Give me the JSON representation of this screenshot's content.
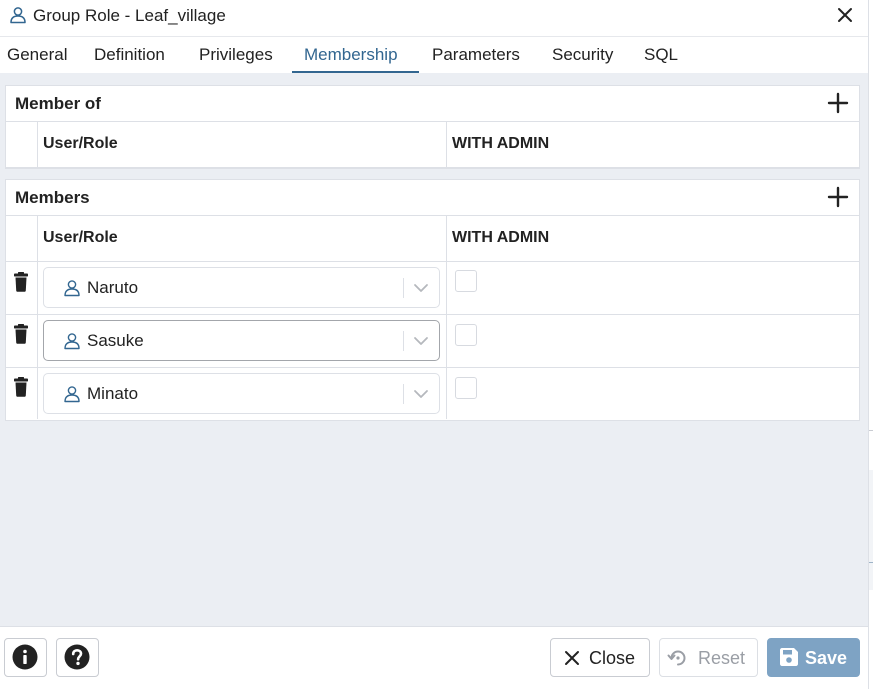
{
  "dialog": {
    "title": "Group Role - Leaf_village",
    "title_icon": "user-icon",
    "close_icon": "close-icon"
  },
  "tabs": [
    {
      "label": "General",
      "active": false
    },
    {
      "label": "Definition",
      "active": false
    },
    {
      "label": "Privileges",
      "active": false
    },
    {
      "label": "Membership",
      "active": true
    },
    {
      "label": "Parameters",
      "active": false
    },
    {
      "label": "Security",
      "active": false
    },
    {
      "label": "SQL",
      "active": false
    }
  ],
  "member_of": {
    "title": "Member of",
    "add_icon": "plus-icon",
    "columns": [
      "User/Role",
      "WITH ADMIN"
    ],
    "rows": []
  },
  "members": {
    "title": "Members",
    "add_icon": "plus-icon",
    "columns": [
      "User/Role",
      "WITH ADMIN"
    ],
    "rows": [
      {
        "role": "Naruto",
        "with_admin": false
      },
      {
        "role": "Sasuke",
        "with_admin": false
      },
      {
        "role": "Minato",
        "with_admin": false
      }
    ]
  },
  "footer": {
    "info_icon": "info-icon",
    "help_icon": "help-icon",
    "close_label": "Close",
    "reset_label": "Reset",
    "save_label": "Save"
  },
  "colors": {
    "accent": "#326690",
    "save_bg": "#7ea3c4",
    "content_bg": "#ebeef3",
    "border": "#dde0e6",
    "disabled_text": "#9a9ea5"
  }
}
